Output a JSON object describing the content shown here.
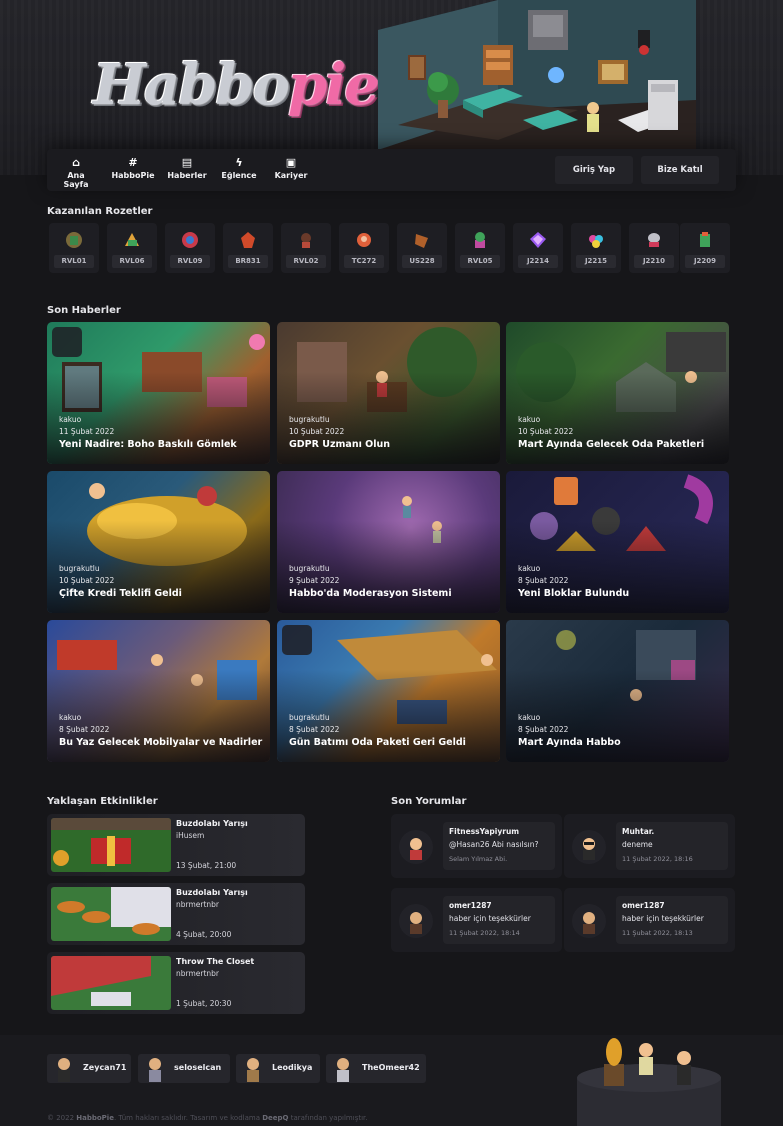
{
  "brand": {
    "logo_part1": "Habbo",
    "logo_part2": "pie"
  },
  "nav": {
    "items": [
      {
        "label": "Ana Sayfa",
        "icon": "home-icon"
      },
      {
        "label": "HabboPie",
        "icon": "hash-icon"
      },
      {
        "label": "Haberler",
        "icon": "news-icon"
      },
      {
        "label": "Eğlence",
        "icon": "lightning-icon"
      },
      {
        "label": "Kariyer",
        "icon": "briefcase-icon"
      }
    ],
    "login_label": "Giriş Yap",
    "register_label": "Bize Katıl"
  },
  "badges": {
    "title": "Kazanılan Rozetler",
    "items": [
      {
        "code": "RVL01"
      },
      {
        "code": "RVL06"
      },
      {
        "code": "RVL09"
      },
      {
        "code": "BR831"
      },
      {
        "code": "RVL02"
      },
      {
        "code": "TC272"
      },
      {
        "code": "US228"
      },
      {
        "code": "RVL05"
      },
      {
        "code": "J2214"
      },
      {
        "code": "J2215"
      },
      {
        "code": "J2210"
      },
      {
        "code": "J2209"
      }
    ]
  },
  "news": {
    "title": "Son Haberler",
    "items": [
      {
        "author": "kakuo",
        "date": "11 Şubat 2022",
        "title": "Yeni Nadire: Boho Baskılı Gömlek"
      },
      {
        "author": "bugrakutlu",
        "date": "10 Şubat 2022",
        "title": "GDPR Uzmanı Olun"
      },
      {
        "author": "kakuo",
        "date": "10 Şubat 2022",
        "title": "Mart Ayında Gelecek Oda Paketleri"
      },
      {
        "author": "bugrakutlu",
        "date": "10 Şubat 2022",
        "title": "Çifte Kredi Teklifi Geldi"
      },
      {
        "author": "bugrakutlu",
        "date": "9 Şubat 2022",
        "title": "Habbo'da Moderasyon Sistemi"
      },
      {
        "author": "kakuo",
        "date": "8 Şubat 2022",
        "title": "Yeni Bloklar Bulundu"
      },
      {
        "author": "kakuo",
        "date": "8 Şubat 2022",
        "title": "Bu Yaz Gelecek Mobilyalar ve Nadirler"
      },
      {
        "author": "bugrakutlu",
        "date": "8 Şubat 2022",
        "title": "Gün Batımı Oda Paketi Geri Geldi"
      },
      {
        "author": "kakuo",
        "date": "8 Şubat 2022",
        "title": "Mart Ayında Habbo"
      }
    ]
  },
  "events": {
    "title": "Yaklaşan Etkinlikler",
    "items": [
      {
        "title": "Buzdolabı Yarışı",
        "host": "iHusem",
        "time": "13 Şubat, 21:00"
      },
      {
        "title": "Buzdolabı Yarışı",
        "host": "nbrmertnbr",
        "time": "4 Şubat, 20:00"
      },
      {
        "title": "Throw The Closet",
        "host": "nbrmertnbr",
        "time": "1 Şubat, 20:30"
      }
    ]
  },
  "comments": {
    "title": "Son Yorumlar",
    "items": [
      {
        "user": "FitnessYapiyrum",
        "text": "@Hasan26 Abi nasılsın?",
        "time": "Selam Yılmaz Abi."
      },
      {
        "user": "Muhtar.",
        "text": "deneme",
        "time": "11 Şubat 2022, 18:16"
      },
      {
        "user": "omer1287",
        "text": "haber için teşekkürler",
        "time": "11 Şubat 2022, 18:14"
      },
      {
        "user": "omer1287",
        "text": "haber için teşekkürler",
        "time": "11 Şubat 2022, 18:13"
      }
    ]
  },
  "footer": {
    "users": [
      "Zeycan71",
      "seloselcan",
      "Leodikya",
      "TheOmeer42"
    ],
    "copyright_prefix": "© 2022 ",
    "copyright_brand": "HabboPie",
    "copyright_mid": ". Tüm hakları saklıdır. Tasarım ve kodlama ",
    "copyright_author": "DeepQ",
    "copyright_suffix": " tarafından yapılmıştır."
  },
  "colors": {
    "background": "#161619",
    "accent_pink": "#f06aa6",
    "card": "#1e1e23"
  }
}
